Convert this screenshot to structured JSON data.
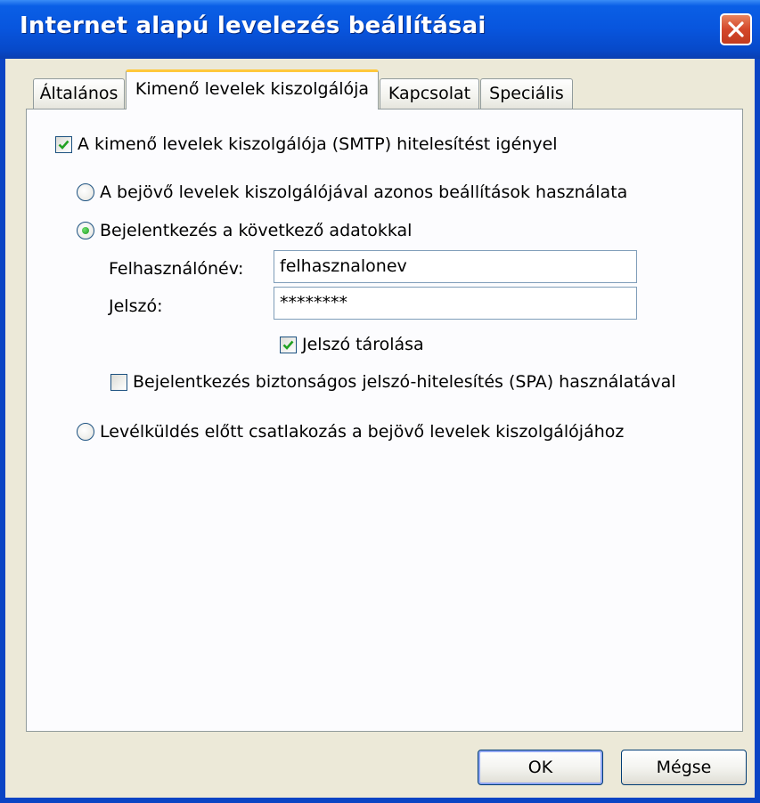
{
  "window": {
    "title": "Internet alapú levelezés beállításai"
  },
  "tabs": [
    {
      "label": "Általános",
      "selected": false
    },
    {
      "label": "Kimenő levelek kiszolgálója",
      "selected": true
    },
    {
      "label": "Kapcsolat",
      "selected": false
    },
    {
      "label": "Speciális",
      "selected": false
    }
  ],
  "smtp_auth": {
    "label": "A kimenő levelek kiszolgálója (SMTP) hitelesítést igényel",
    "checked": true
  },
  "options": {
    "same_as_incoming": {
      "label": "A bejövő levelek kiszolgálójával azonos beállítások használata",
      "selected": false
    },
    "log_on_using": {
      "label": "Bejelentkezés a következő adatokkal",
      "selected": true
    },
    "log_on_before_send": {
      "label": "Levélküldés előtt csatlakozás a bejövő levelek kiszolgálójához",
      "selected": false
    }
  },
  "credentials": {
    "username_label": "Felhasználónév:",
    "username_value": "felhasznalonev",
    "password_label": "Jelszó:",
    "password_value": "********"
  },
  "remember_password": {
    "label": "Jelszó tárolása",
    "checked": true
  },
  "spa": {
    "label": "Bejelentkezés biztonságos jelszó-hitelesítés (SPA) használatával",
    "checked": false
  },
  "buttons": {
    "ok": "OK",
    "cancel": "Mégse"
  },
  "colors": {
    "titlebar": "#0855dd",
    "tab_highlight": "#ffc83c",
    "check_mark": "#21a121",
    "close_button": "#d4472a"
  }
}
